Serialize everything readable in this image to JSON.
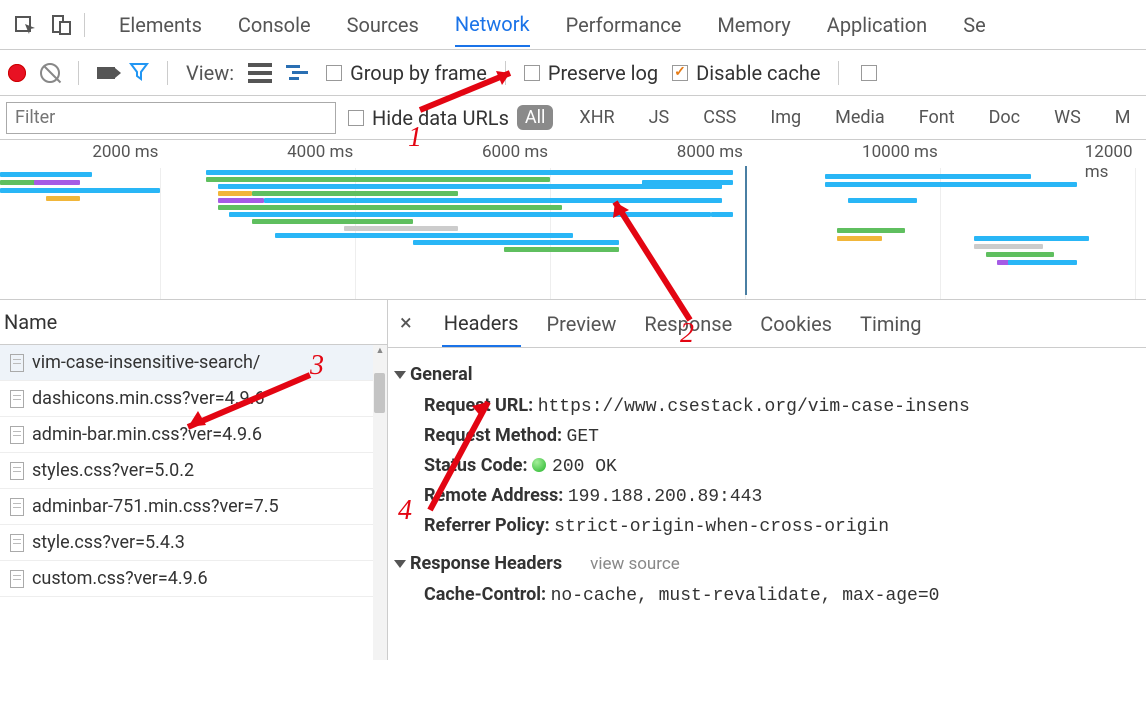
{
  "devtools_tabs": [
    "Elements",
    "Console",
    "Sources",
    "Network",
    "Performance",
    "Memory",
    "Application",
    "Se"
  ],
  "devtools_active": "Network",
  "toolbar": {
    "view_label": "View:",
    "group_by_frame": "Group by frame",
    "preserve_log": "Preserve log",
    "disable_cache": "Disable cache"
  },
  "filter": {
    "placeholder": "Filter",
    "hide_data_urls": "Hide data URLs",
    "types": [
      "All",
      "XHR",
      "JS",
      "CSS",
      "Img",
      "Media",
      "Font",
      "Doc",
      "WS",
      "M"
    ],
    "types_active": "All"
  },
  "timeline": {
    "ticks": [
      "2000 ms",
      "4000 ms",
      "6000 ms",
      "8000 ms",
      "10000 ms",
      "12000 ms"
    ]
  },
  "requests_header": "Name",
  "requests": [
    "vim-case-insensitive-search/",
    "dashicons.min.css?ver=4.9.6",
    "admin-bar.min.css?ver=4.9.6",
    "styles.css?ver=5.0.2",
    "adminbar-751.min.css?ver=7.5",
    "style.css?ver=5.4.3",
    "custom.css?ver=4.9.6"
  ],
  "detail_tabs": [
    "Headers",
    "Preview",
    "Response",
    "Cookies",
    "Timing"
  ],
  "detail_tabs_active": "Headers",
  "headers": {
    "general_title": "General",
    "request_url_label": "Request URL:",
    "request_url": "https://www.csestack.org/vim-case-insens",
    "request_method_label": "Request Method:",
    "request_method": "GET",
    "status_code_label": "Status Code:",
    "status_code": "200 OK",
    "remote_addr_label": "Remote Address:",
    "remote_addr": "199.188.200.89:443",
    "referrer_label": "Referrer Policy:",
    "referrer": "strict-origin-when-cross-origin",
    "response_headers_title": "Response Headers",
    "view_source": "view source",
    "cache_control_label": "Cache-Control:",
    "cache_control": "no-cache, must-revalidate, max-age=0"
  },
  "annotations": {
    "n1": "1",
    "n2": "2",
    "n3": "3",
    "n4": "4"
  }
}
